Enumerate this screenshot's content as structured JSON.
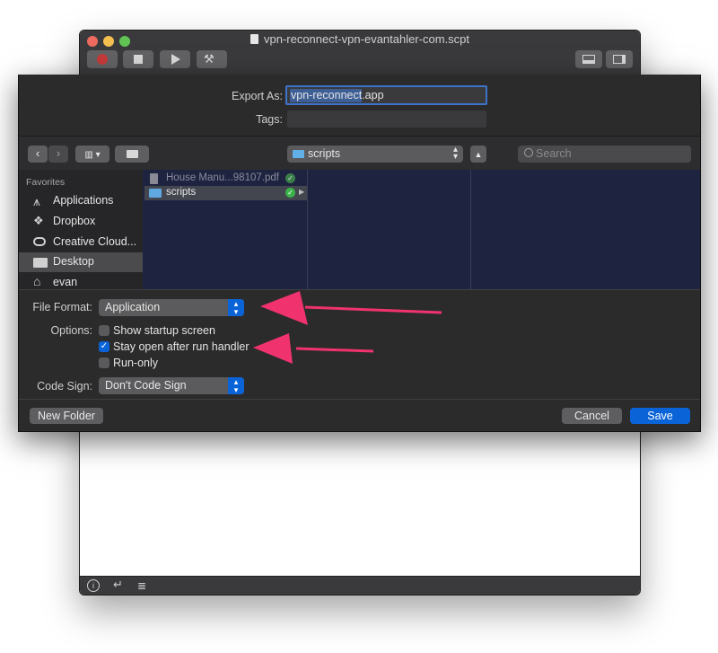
{
  "window": {
    "title": "vpn-reconnect-vpn-evantahler-com.scpt"
  },
  "dialog": {
    "export_as_label": "Export As:",
    "export_as_value": "vpn-reconnect.app",
    "tags_label": "Tags:",
    "location": "scripts",
    "search_placeholder": "Search",
    "sidebar_header": "Favorites",
    "sidebar_items": [
      {
        "label": "Applications",
        "icon": "applications-icon"
      },
      {
        "label": "Dropbox",
        "icon": "dropbox-icon"
      },
      {
        "label": "Creative Cloud...",
        "icon": "creative-cloud-icon"
      },
      {
        "label": "Desktop",
        "icon": "folder-icon",
        "selected": true
      },
      {
        "label": "evan",
        "icon": "home-icon"
      }
    ],
    "files": [
      {
        "name": "House Manu...98107.pdf",
        "dimmed": true
      },
      {
        "name": "scripts",
        "selected": true
      }
    ],
    "file_format_label": "File Format:",
    "file_format_value": "Application",
    "options_label": "Options:",
    "options": [
      {
        "label": "Show startup screen",
        "checked": false
      },
      {
        "label": "Stay open after run handler",
        "checked": true
      },
      {
        "label": "Run-only",
        "checked": false
      }
    ],
    "code_sign_label": "Code Sign:",
    "code_sign_value": "Don't Code Sign",
    "new_folder_label": "New Folder",
    "cancel_label": "Cancel",
    "save_label": "Save"
  },
  "colors": {
    "accent": "#0a64d8",
    "annotation_arrow": "#f0336e",
    "sheet_bg": "#2b2b2b",
    "browser_bg": "#1e2340"
  }
}
